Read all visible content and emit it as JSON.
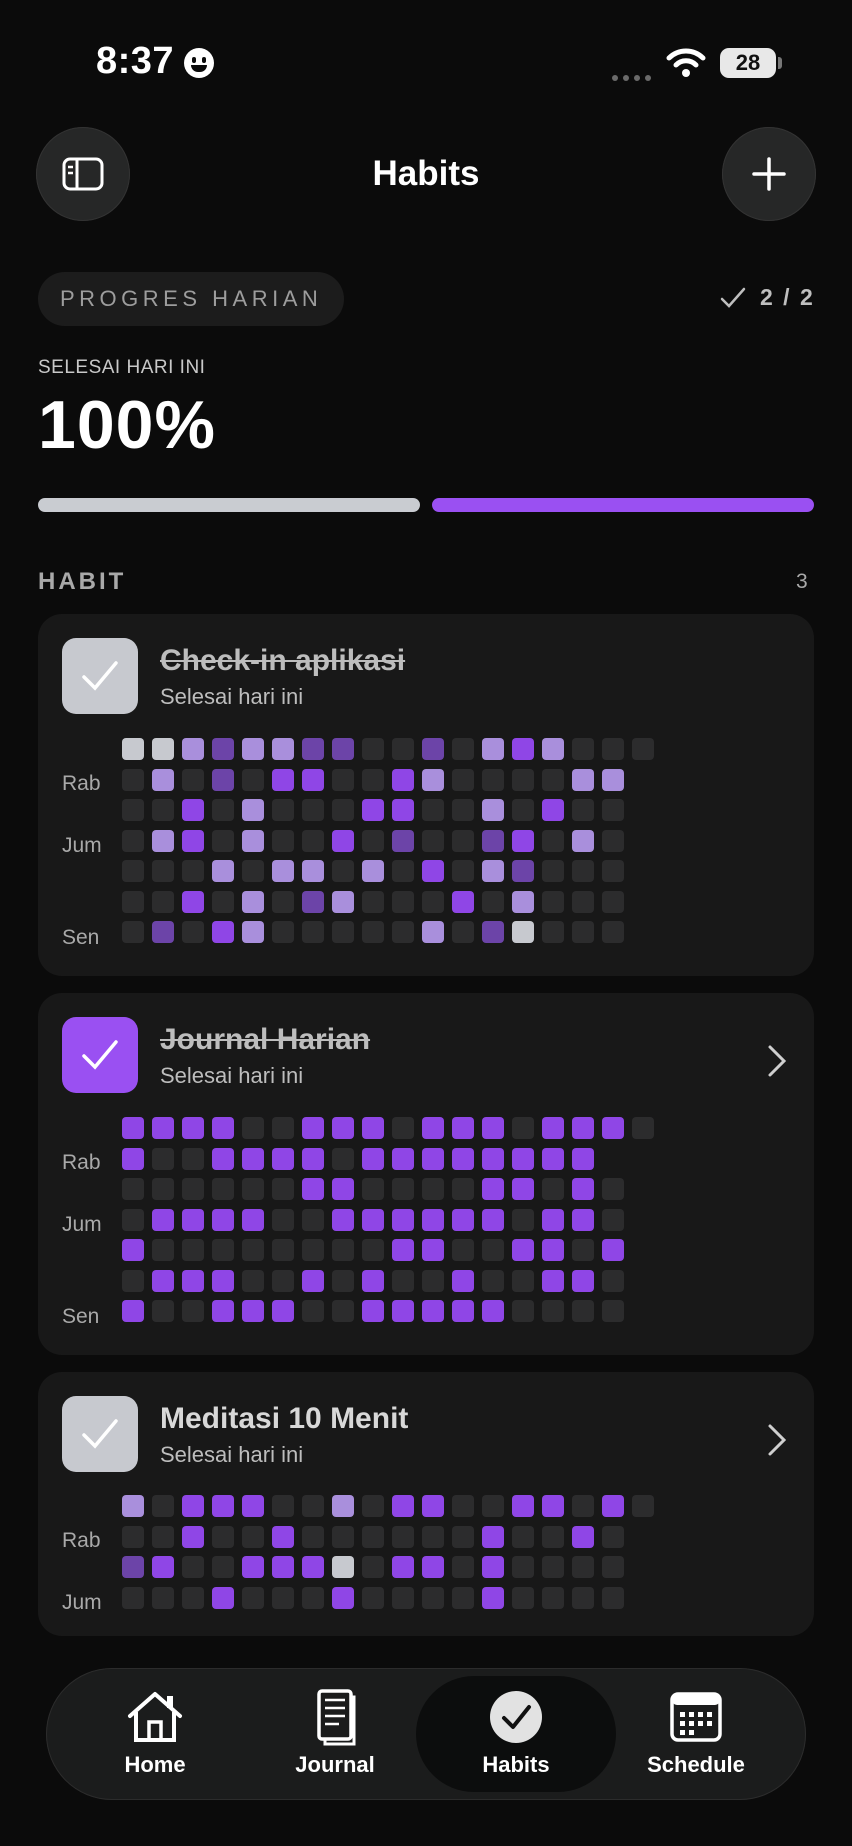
{
  "status_bar": {
    "time": "8:37",
    "battery": "28"
  },
  "header": {
    "title": "Habits",
    "sidebar_icon": "sidebar-icon",
    "add_icon": "plus-icon"
  },
  "progress": {
    "pill_label": "PROGRES HARIAN",
    "count": "2 / 2",
    "sub_label": "SELESAI HARI INI",
    "percent": "100%",
    "segments": [
      "#c9ccd1",
      "#9a50f2"
    ]
  },
  "habits_section": {
    "label": "HABIT",
    "count": "3"
  },
  "colors": {
    "accent": "#9a50f2",
    "check_gray": "#c7c9cf"
  },
  "day_labels": {
    "rab": "Rab",
    "jum": "Jum",
    "sen": "Sen"
  },
  "habits": [
    {
      "name": "Check-in aplikasi",
      "status": "Selesai hari ini",
      "done": true,
      "check_color": "gray",
      "grid": [
        "GGLMLLMMaaMaLPLaaa",
        "aLaMaPPaaPLaaaaLL",
        "aaPaLaaaPPaaLaPaa",
        "aLPaLaaPaMaaMPaLa",
        "aaaLaLLaLaPaLMaaa",
        "aaPaLaMLaaaPaLaaa",
        "aMaPLaaaaaLaMGaaa"
      ]
    },
    {
      "name": "Journal Harian",
      "status": "Selesai hari ini",
      "done": true,
      "check_color": "purple",
      "grid": [
        "PPPPaaPPPaPPPaPPPa",
        "PaaPPPPaPPPPPPPP",
        "aaaaaaPPaaaaPPaPa",
        "aPPPPaaPPPPPPaPPa",
        "PaaaaaaaaPPaaPPaP",
        "aPPPaaPaPaaPaaPPa",
        "PaaPPPaaPPPPPaaaa"
      ]
    },
    {
      "name": "Meditasi 10 Menit",
      "status": "Selesai hari ini",
      "done": false,
      "check_color": "gray",
      "grid": [
        "LaPPPaaLaPPaaPPaPa",
        "aaPaaPaaaaaaPaaPa",
        "MPaaPPPGaPPaPaaaa",
        "aaaPaaaPaaaaPaaaa"
      ]
    }
  ],
  "nav": [
    {
      "label": "Home",
      "icon": "home-icon"
    },
    {
      "label": "Journal",
      "icon": "journal-icon"
    },
    {
      "label": "Habits",
      "icon": "habits-check-icon",
      "active": true
    },
    {
      "label": "Schedule",
      "icon": "calendar-icon"
    }
  ]
}
